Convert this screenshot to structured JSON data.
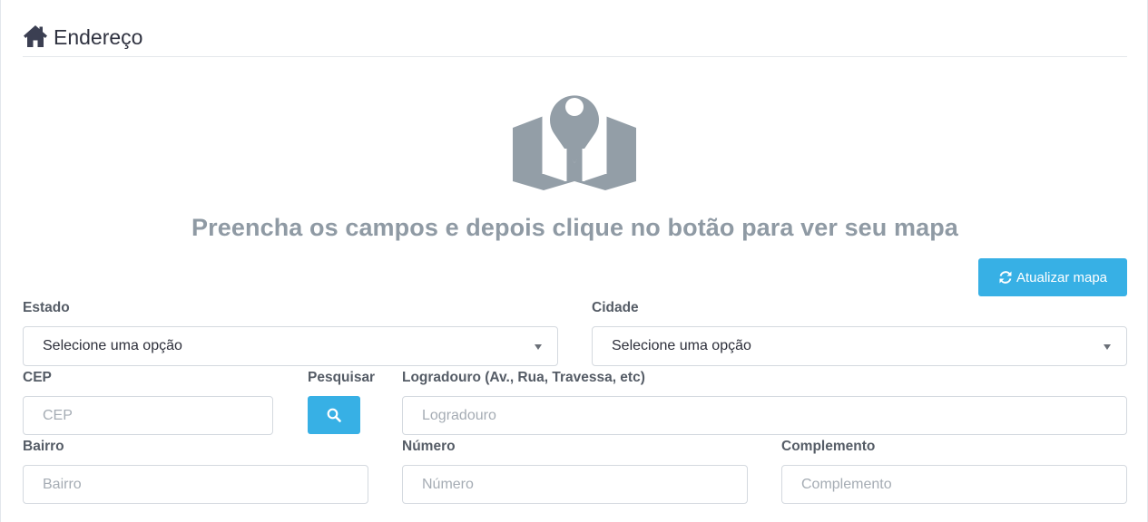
{
  "section": {
    "title": "Endereço"
  },
  "map_placeholder": {
    "message": "Preencha os campos e depois clique no botão para ver seu mapa"
  },
  "buttons": {
    "update_map": "Atualizar mapa"
  },
  "fields": {
    "estado": {
      "label": "Estado",
      "value": "Selecione uma opção"
    },
    "cidade": {
      "label": "Cidade",
      "value": "Selecione uma opção"
    },
    "cep": {
      "label": "CEP",
      "placeholder": "CEP"
    },
    "pesquisar": {
      "label": "Pesquisar"
    },
    "logradouro": {
      "label": "Logradouro (Av., Rua, Travessa, etc)",
      "placeholder": "Logradouro"
    },
    "bairro": {
      "label": "Bairro",
      "placeholder": "Bairro"
    },
    "numero": {
      "label": "Número",
      "placeholder": "Número"
    },
    "complemento": {
      "label": "Complemento",
      "placeholder": "Complemento"
    }
  },
  "icons": {
    "section": "home-icon",
    "placeholder": "map-marker-icon",
    "update": "refresh-icon",
    "search": "search-icon"
  },
  "colors": {
    "accent": "#37b0e5",
    "placeholder_gray": "#909ba5",
    "text_dark": "#2f3240"
  }
}
